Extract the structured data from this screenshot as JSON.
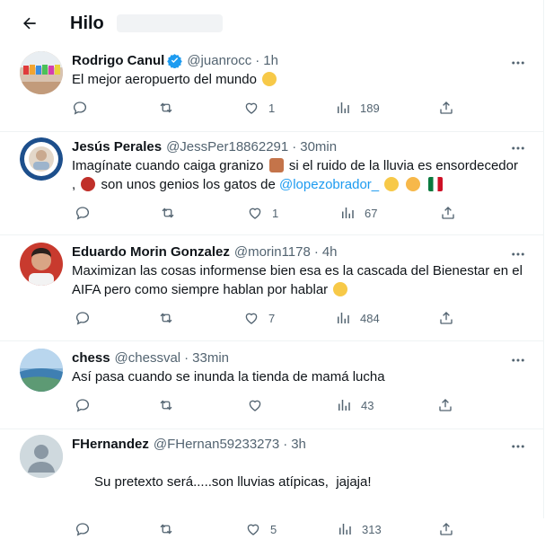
{
  "header": {
    "title": "Hilo"
  },
  "tweets": [
    {
      "name": "Rodrigo Canul",
      "verified": true,
      "handle": "@juanrocc",
      "time": "1h",
      "text": "El mejor aeropuerto del mundo",
      "likes": "1",
      "views": "189",
      "avatar_icon": "colorful-letters-avatar"
    },
    {
      "name": "Jesús Perales",
      "handle": "@JessPer18862291",
      "time": "30min",
      "text_a": "Imagínate cuando caiga granizo",
      "text_b": "si el ruido de la lluvia es ensordecedor",
      "text_c": ",",
      "text_d": "son unos genios los gatos de",
      "mention": "@lopezobrador_",
      "likes": "1",
      "views": "67",
      "avatar_icon": "seal-avatar"
    },
    {
      "name": "Eduardo Morin Gonzalez",
      "handle": "@morin1178",
      "time": "4h",
      "text": "Maximizan las cosas informense bien esa es la cascada del Bienestar en el AIFA pero como siempre hablan por hablar",
      "likes": "7",
      "views": "484",
      "avatar_icon": "person-avatar"
    },
    {
      "name": "chess",
      "handle": "@chessval",
      "time": "33min",
      "text": "Así pasa cuando se inunda la tienda de mamá lucha",
      "likes": "",
      "views": "43",
      "avatar_icon": "landscape-avatar"
    },
    {
      "name": "FHernandez",
      "handle": "@FHernan59233273",
      "time": "3h",
      "text": "Su pretexto será.....son lluvias atípicas,  jajaja!",
      "likes": "5",
      "views": "313",
      "avatar_icon": "default-avatar"
    }
  ],
  "colors": {
    "link": "#1d9bf0",
    "muted": "#536471",
    "divider": "#eff3f4"
  }
}
